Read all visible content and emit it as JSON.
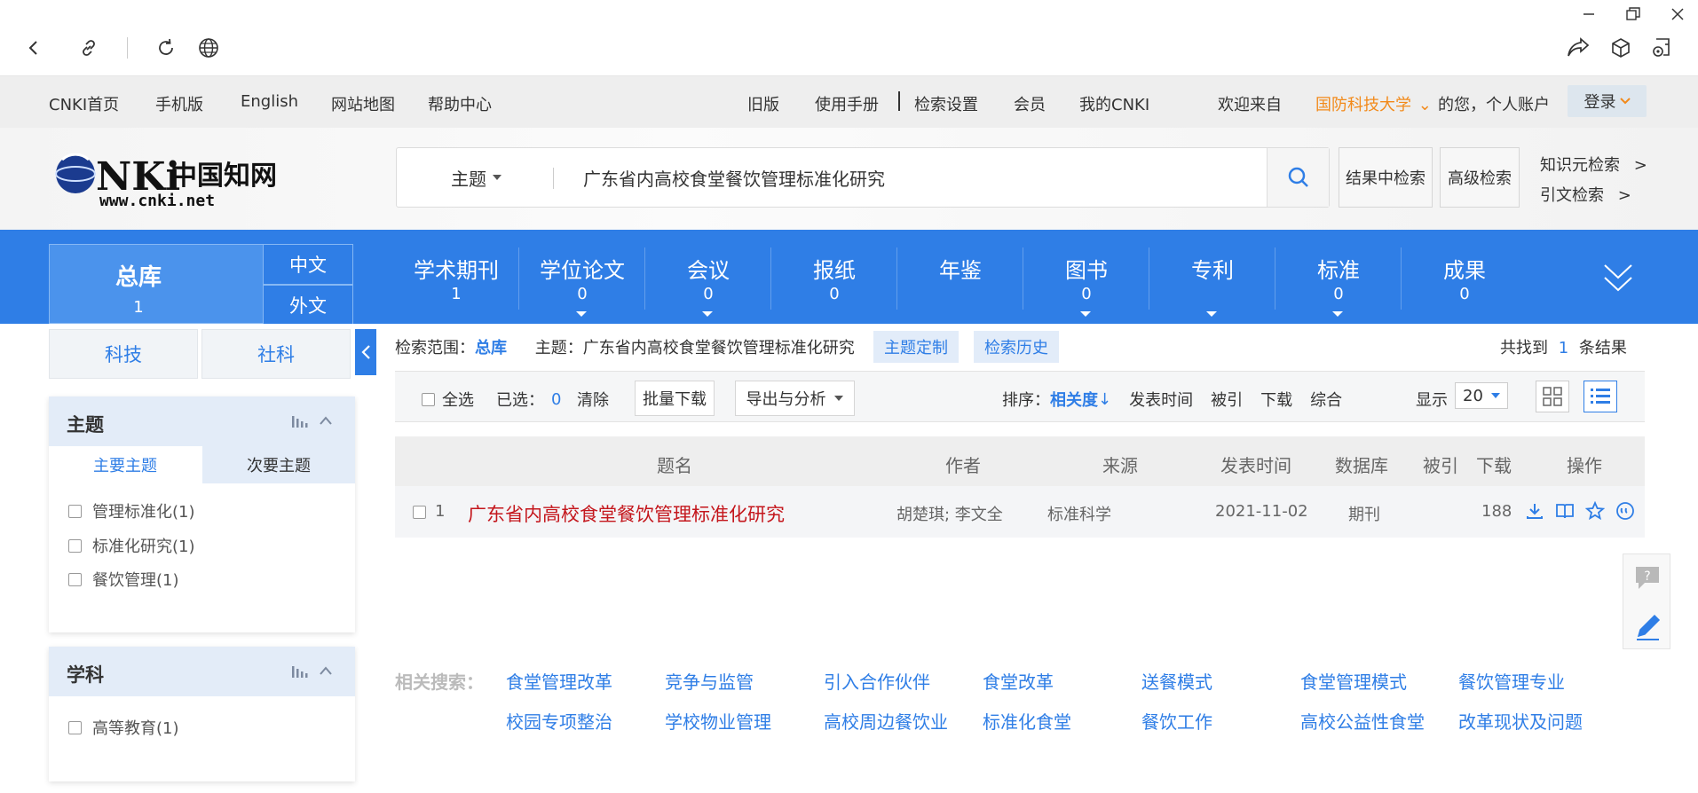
{
  "topnav": {
    "left": [
      "CNKI首页",
      "手机版",
      "English",
      "网站地图",
      "帮助中心"
    ],
    "right": [
      "旧版",
      "使用手册",
      "检索设置",
      "会员",
      "我的CNKI"
    ],
    "welcome": "欢迎来自",
    "institution": "国防科技大学",
    "account": "的您，个人账户",
    "login": "登录"
  },
  "search": {
    "field": "主题",
    "query": "广东省内高校食堂餐饮管理标准化研究",
    "in_results": "结果中检索",
    "advanced": "高级检索",
    "knowledge_search": "知识元检索",
    "citation_search": "引文检索",
    "arrow": ">"
  },
  "databases": {
    "total": {
      "name": "总库",
      "count": "1"
    },
    "lang_cn": "中文",
    "lang_foreign": "外文",
    "tabs": [
      {
        "name": "学术期刊",
        "count": "1"
      },
      {
        "name": "学位论文",
        "count": "0"
      },
      {
        "name": "会议",
        "count": "0"
      },
      {
        "name": "报纸",
        "count": "0"
      },
      {
        "name": "年鉴",
        "count": ""
      },
      {
        "name": "图书",
        "count": "0"
      },
      {
        "name": "专利",
        "count": ""
      },
      {
        "name": "标准",
        "count": "0"
      },
      {
        "name": "成果",
        "count": "0"
      }
    ]
  },
  "sidebar": {
    "sci": "科技",
    "soc": "社科",
    "topic": {
      "title": "主题",
      "tab_main": "主要主题",
      "tab_secondary": "次要主题",
      "items": [
        "管理标准化(1)",
        "标准化研究(1)",
        "餐饮管理(1)"
      ]
    },
    "subject": {
      "title": "学科",
      "items": [
        "高等教育(1)"
      ]
    }
  },
  "results": {
    "scope_label": "检索范围：",
    "scope_value": "总库",
    "scope_query": "主题：广东省内高校食堂餐饮管理标准化研究",
    "custom_topic": "主题定制",
    "history": "检索历史",
    "found_prefix": "共找到",
    "found_count": "1",
    "found_suffix": "条结果",
    "select_all": "全选",
    "selected_label": "已选：",
    "selected_count": "0",
    "clear": "清除",
    "batch_download": "批量下载",
    "export": "导出与分析",
    "sort_label": "排序：",
    "sort_options": [
      "相关度",
      "发表时间",
      "被引",
      "下载",
      "综合"
    ],
    "display_label": "显示",
    "page_size": "20",
    "columns": [
      "题名",
      "作者",
      "来源",
      "发表时间",
      "数据库",
      "被引",
      "下载",
      "操作"
    ],
    "rows": [
      {
        "index": "1",
        "title": "广东省内高校食堂餐饮管理标准化研究",
        "author": "胡楚琪; 李文全",
        "source": "标准科学",
        "date": "2021-11-02",
        "db": "期刊",
        "cited": "",
        "downloads": "188"
      }
    ]
  },
  "related": {
    "label": "相关搜索：",
    "row1": [
      "食堂管理改革",
      "竞争与监管",
      "引入合作伙伴",
      "食堂改革",
      "送餐模式",
      "食堂管理模式",
      "餐饮管理专业"
    ],
    "row2": [
      "校园专项整治",
      "学校物业管理",
      "高校周边餐饮业",
      "标准化食堂",
      "餐饮工作",
      "高校公益性食堂",
      "改革现状及问题"
    ]
  },
  "logo": {
    "text": "www.cnki.net",
    "cn": "中国知网"
  },
  "colors": {
    "accent": "#2f7ee6",
    "title_red": "#c4161c",
    "institution": "#f28a1b"
  }
}
